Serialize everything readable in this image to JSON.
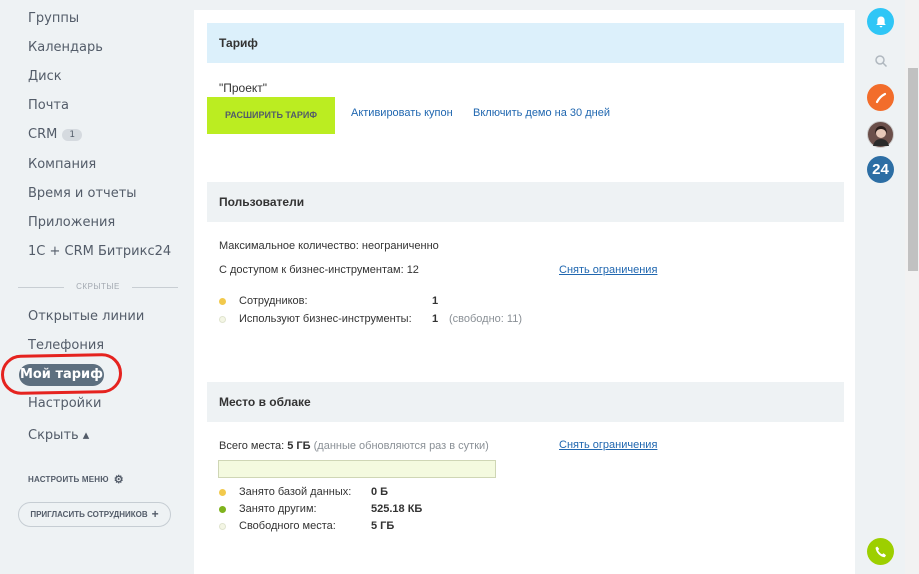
{
  "sidebar": {
    "items": [
      {
        "label": "Группы"
      },
      {
        "label": "Календарь"
      },
      {
        "label": "Диск"
      },
      {
        "label": "Почта"
      },
      {
        "label": "CRM",
        "badge": "1"
      },
      {
        "label": "Компания"
      },
      {
        "label": "Время и отчеты"
      },
      {
        "label": "Приложения"
      },
      {
        "label": "1С + CRM Битрикс24"
      }
    ],
    "hidden_label": "СКРЫТЫЕ",
    "hidden_items": [
      {
        "label": "Открытые линии"
      },
      {
        "label": "Телефония"
      }
    ],
    "active_item": "Мой тариф",
    "after_items": [
      {
        "label": "Настройки"
      },
      {
        "label": "Скрыть ▴"
      }
    ],
    "setup_menu": "НАСТРОИТЬ МЕНЮ",
    "invite": "ПРИГЛАСИТЬ СОТРУДНИКОВ"
  },
  "tariff": {
    "title": "Тариф",
    "plan_name": "\"Проект\"",
    "upgrade_button": "РАСШИРИТЬ ТАРИФ",
    "coupon_link": "Активировать купон",
    "demo_link": "Включить демо на 30 дней"
  },
  "users": {
    "title": "Пользователи",
    "max_count": "Максимальное количество: неограниченно",
    "business_access": "С доступом к бизнес-инструментам: 12",
    "remove_limits": "Снять ограничения",
    "employees_label": "Сотрудников:",
    "employees_value": "1",
    "tools_label": "Используют бизнес-инструменты:",
    "tools_value": "1",
    "tools_free": "(свободно: 11)"
  },
  "cloud": {
    "title": "Место в облаке",
    "total_label": "Всего места:",
    "total_value": "5 ГБ",
    "total_note": "(данные обновляются раз в сутки)",
    "remove_limits": "Снять ограничения",
    "used_fraction": 0.0001,
    "db_label": "Занято базой данных:",
    "db_value": "0 Б",
    "other_label": "Занято другим:",
    "other_value": "525.18 КБ",
    "free_label": "Свободного места:",
    "free_value": "5 ГБ"
  },
  "rightbar": {
    "b24_label": "24"
  },
  "colors": {
    "accent_green": "#bbed21",
    "link_blue": "#2067b0",
    "header_blue": "#dcf0fb",
    "highlight_red": "#e5231f"
  }
}
